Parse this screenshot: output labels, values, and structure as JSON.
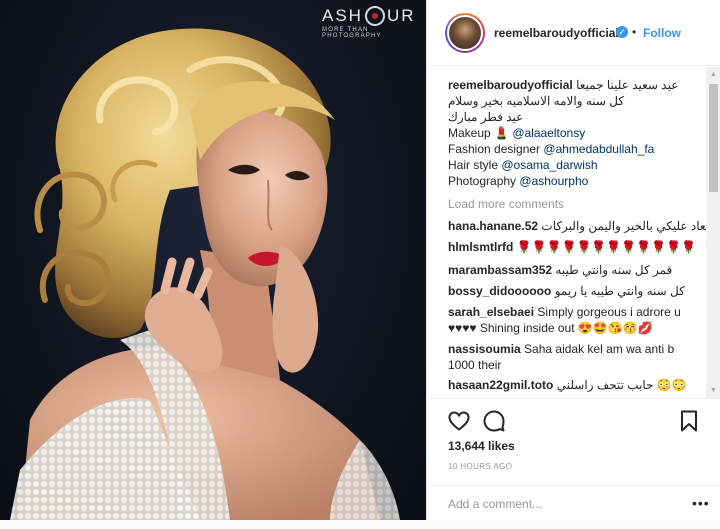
{
  "photo": {
    "watermark_brand": "ASH",
    "watermark_brand_end": "UR",
    "watermark_tagline": "MORE THAN PHOTOGRAPHY"
  },
  "header": {
    "username": "reemelbaroudyofficial",
    "separator": "•",
    "follow_label": "Follow"
  },
  "caption": {
    "username": "reemelbaroudyofficial",
    "line1": "عيد سعيد علينا جميعا",
    "line2": "كل سنه والامه الاسلاميه بخير وسلام",
    "line3": "عيد فطر مبارك",
    "credits": [
      {
        "label": "Makeup 💄 ",
        "mention": "@alaaeltonsy"
      },
      {
        "label": "Fashion designer ",
        "mention": "@ahmedabdullah_fa"
      },
      {
        "label": "Hair style ",
        "mention": "@osama_darwish"
      },
      {
        "label": "Photography ",
        "mention": "@ashourpho"
      }
    ]
  },
  "load_more": "Load more comments",
  "comments": [
    {
      "user": "hana.hanane.52",
      "text": "ينعاد عليكي بالخير واليمن والبركات"
    },
    {
      "user": "hlmlsmtlrfd",
      "text": "🌹🌹🌹🌹🌹🌹🌹🌹🌹🌹🌹🌹"
    },
    {
      "user": "marambassam352",
      "text": "قمر كل سنه وانتي طيبه"
    },
    {
      "user": "bossy_didoooooo",
      "text": "كل سنه وانتي طيبه يا ريمو"
    },
    {
      "user": "sarah_elsebaei",
      "text": "Simply gorgeous i adrore u",
      "text2": "♥♥♥♥ Shining inside out 😍🤩😘😚💋"
    },
    {
      "user": "nassisoumia",
      "text": "Saha aidak kel am wa anti b",
      "text2": "1000 their"
    },
    {
      "user": "hasaan22gmil.toto",
      "text": "حابب تتحف راسلني 😳😳"
    }
  ],
  "actions": {
    "likes": "13,644 likes",
    "time": "10 HOURS AGO",
    "comment_placeholder": "Add a comment...",
    "more": "•••"
  }
}
